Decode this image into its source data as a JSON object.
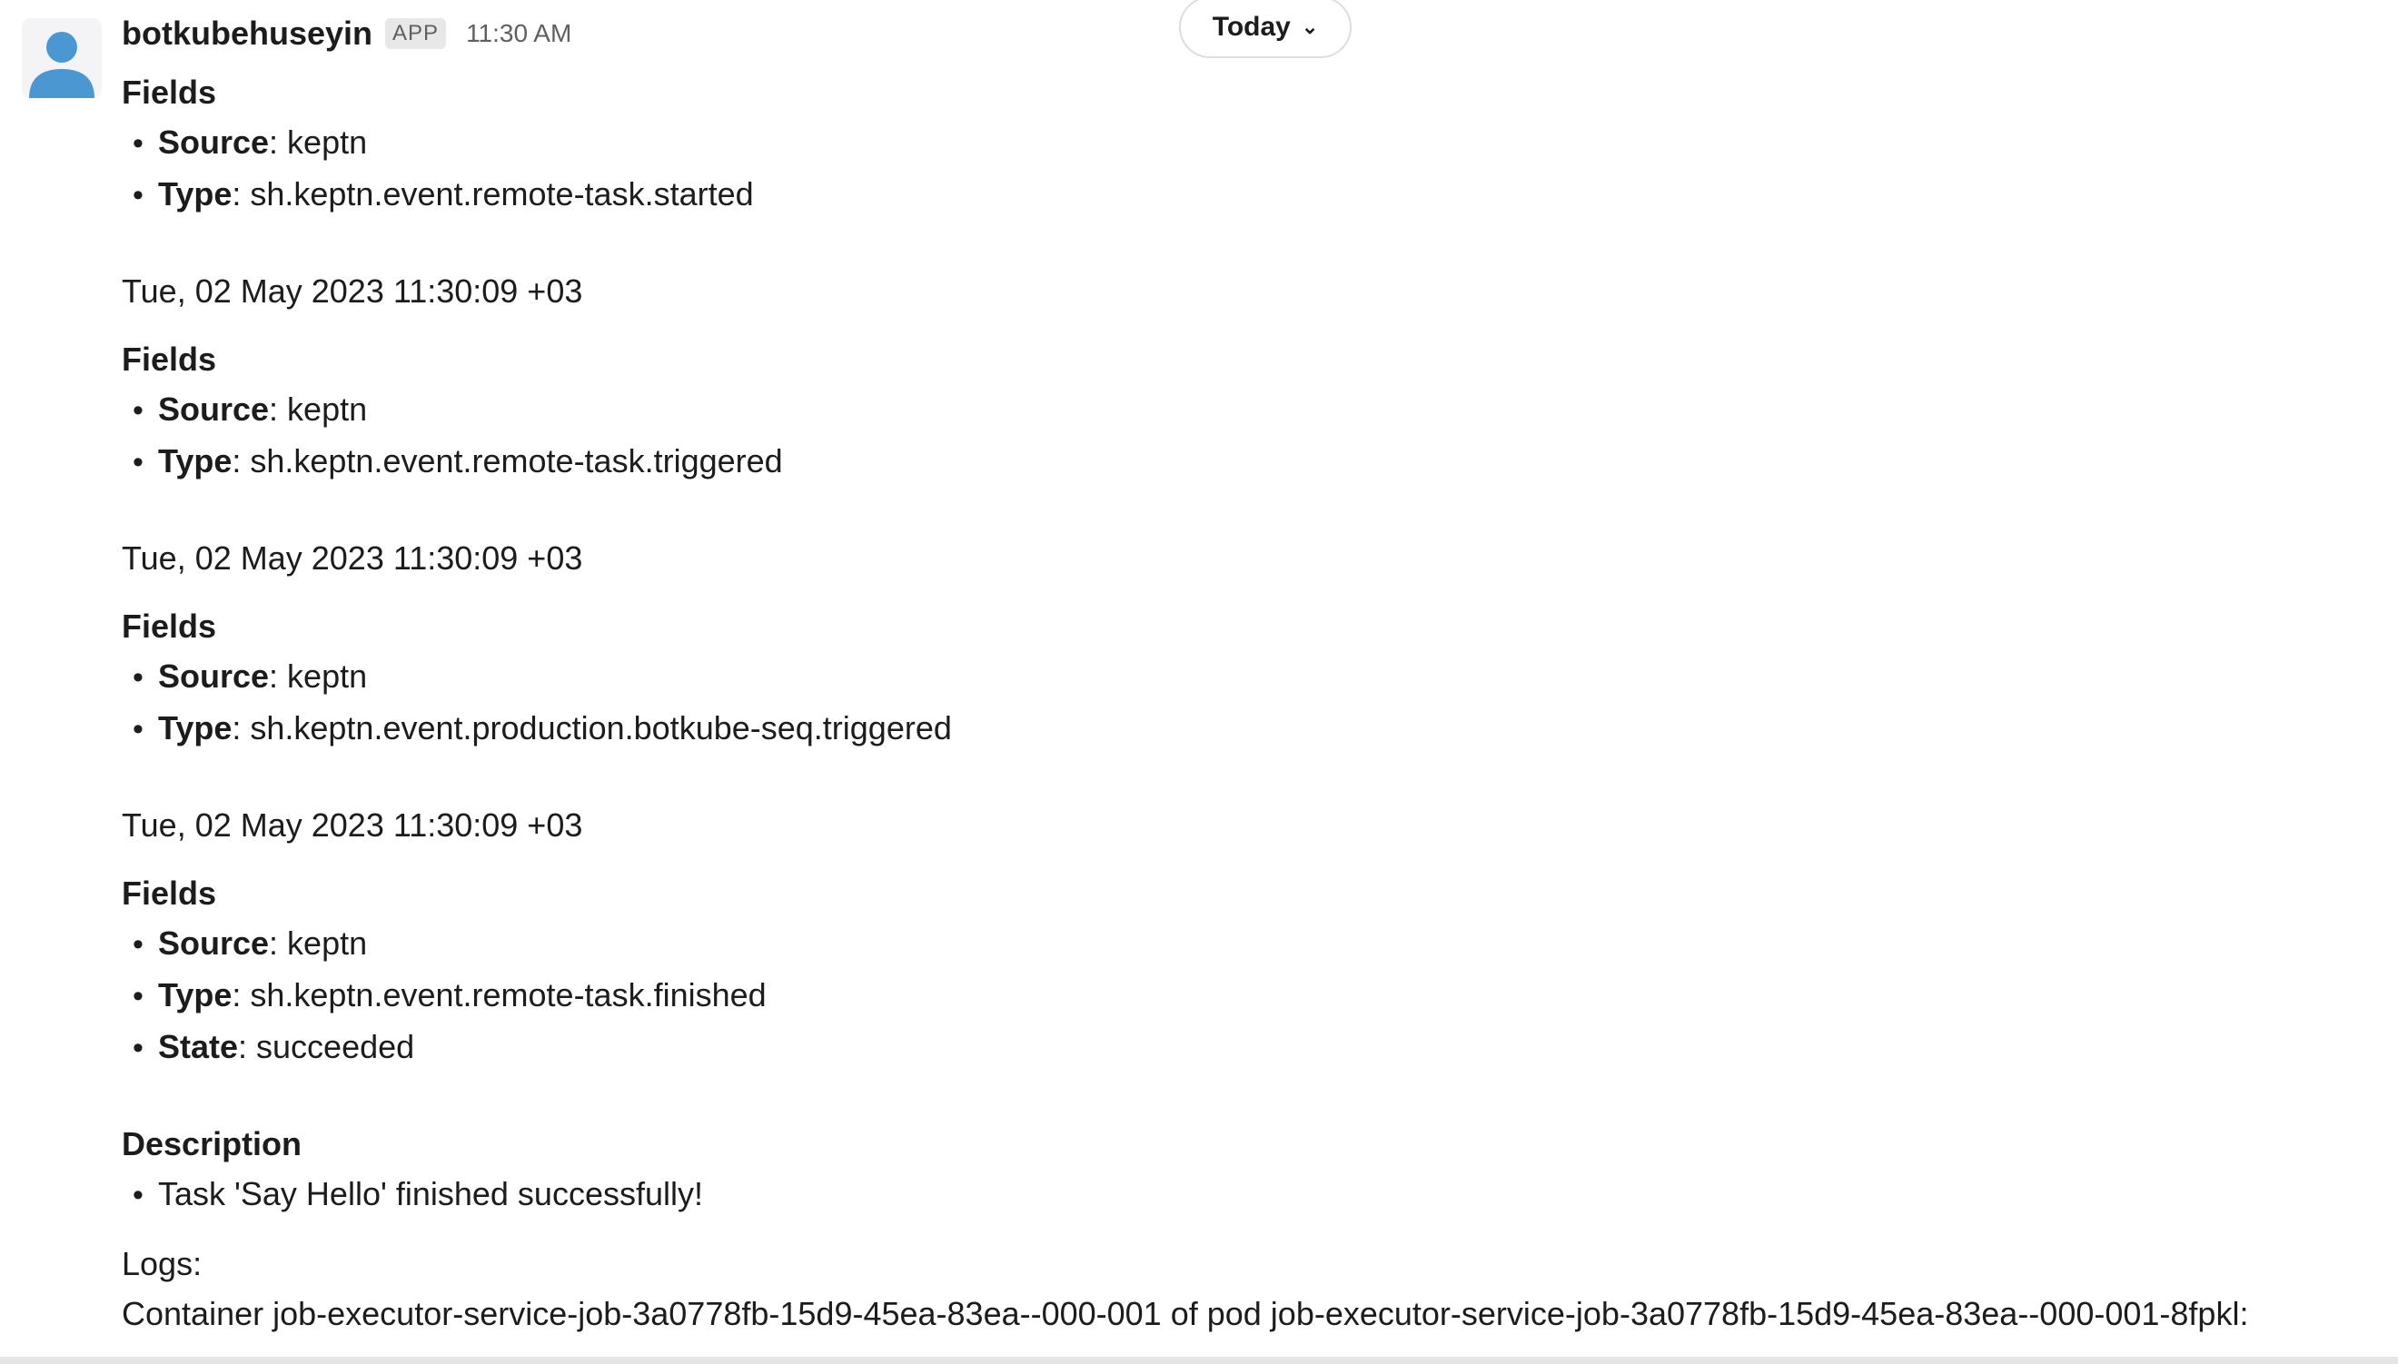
{
  "message": {
    "sender": "botkubehuseyin",
    "badge": "APP",
    "time": "11:30 AM"
  },
  "date_pill": {
    "label": "Today",
    "chevron": "chevron-down-icon"
  },
  "blocks": {
    "b1": {
      "title": "Fields",
      "source_key": "Source",
      "source_val": ": keptn",
      "type_key": "Type",
      "type_val": ": sh.keptn.event.remote-task.started"
    },
    "ts2": "Tue, 02 May 2023 11:30:09 +03",
    "b2": {
      "title": "Fields",
      "source_key": "Source",
      "source_val": ": keptn",
      "type_key": "Type",
      "type_val": ": sh.keptn.event.remote-task.triggered"
    },
    "ts3": "Tue, 02 May 2023 11:30:09 +03",
    "b3": {
      "title": "Fields",
      "source_key": "Source",
      "source_val": ": keptn",
      "type_key": "Type",
      "type_val": ": sh.keptn.event.production.botkube-seq.triggered"
    },
    "ts4": "Tue, 02 May 2023 11:30:09 +03",
    "b4": {
      "title": "Fields",
      "source_key": "Source",
      "source_val": ": keptn",
      "type_key": "Type",
      "type_val": ": sh.keptn.event.remote-task.finished",
      "state_key": "State",
      "state_val": ": succeeded"
    },
    "description": {
      "title": "Description",
      "item": "Task 'Say Hello' finished successfully!"
    },
    "logs": {
      "label": "Logs:",
      "line1": "Container job-executor-service-job-3a0778fb-15d9-45ea-83ea--000-001 of pod job-executor-service-job-3a0778fb-15d9-45ea-83ea--000-001-8fpkl:"
    }
  }
}
